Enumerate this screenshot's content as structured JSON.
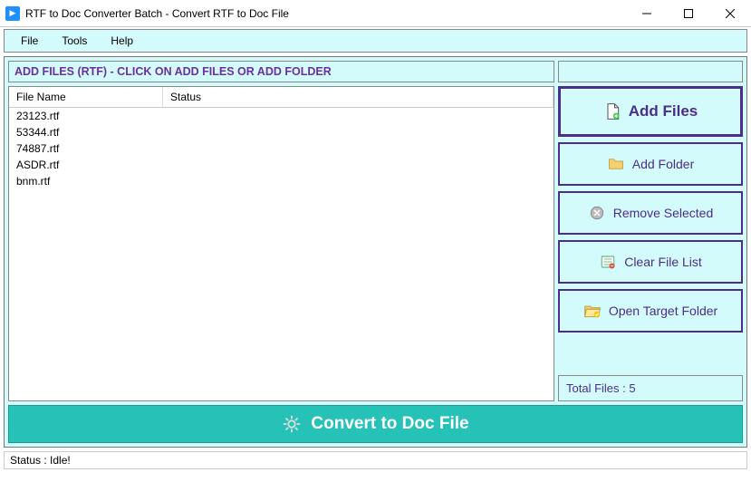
{
  "window": {
    "title": "RTF to Doc Converter Batch -  Convert RTF to Doc File"
  },
  "menu": {
    "items": [
      "File",
      "Tools",
      "Help"
    ]
  },
  "instruction": "ADD FILES (RTF) - CLICK ON ADD FILES OR ADD FOLDER",
  "columns": {
    "name": "File Name",
    "status": "Status"
  },
  "files": [
    {
      "name": "23123.rtf",
      "status": ""
    },
    {
      "name": "53344.rtf",
      "status": ""
    },
    {
      "name": "74887.rtf",
      "status": ""
    },
    {
      "name": "ASDR.rtf",
      "status": ""
    },
    {
      "name": "bnm.rtf",
      "status": ""
    }
  ],
  "buttons": {
    "add_files": "Add Files",
    "add_folder": "Add Folder",
    "remove_selected": "Remove Selected",
    "clear_list": "Clear File List",
    "open_target": "Open Target Folder"
  },
  "total_files_label": "Total Files : 5",
  "convert_label": "Convert to Doc File",
  "status_text": "Status  :  Idle!"
}
